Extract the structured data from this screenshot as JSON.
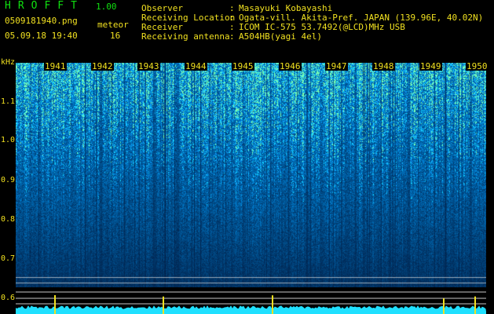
{
  "header": {
    "brand": "HROFFT",
    "version": "1.00",
    "filename": "0509181940.png",
    "datetime": "05.09.18 19:40",
    "meteor_label": "meteor",
    "meteor_count": "16"
  },
  "info": [
    {
      "key": "Observer",
      "value": "Masayuki Kobayashi"
    },
    {
      "key": "Receiving Location",
      "value": "Ogata-vill. Akita-Pref. JAPAN (139.96E, 40.02N)"
    },
    {
      "key": "Receiver",
      "value": "ICOM IC-575 53.7492(@LCD)MHz USB"
    },
    {
      "key": "Receiving antenna",
      "value": "A504HB(yagi 4el)"
    }
  ],
  "y_axis": {
    "unit": "kHz",
    "ticks": [
      "1.1",
      "1.0",
      "0.9",
      "0.8",
      "0.7",
      "0.6"
    ]
  },
  "time_axis": {
    "ticks": [
      "1941",
      "1942",
      "1943",
      "1944",
      "1945",
      "1946",
      "1947",
      "1948",
      "1949",
      "1950"
    ]
  },
  "colors": {
    "background": "#000000",
    "label": "#f0e020",
    "brand": "#10e010",
    "spectrum_high": "#40f0a0",
    "spectrum_low": "#001060",
    "meter": "#20e0ff"
  }
}
